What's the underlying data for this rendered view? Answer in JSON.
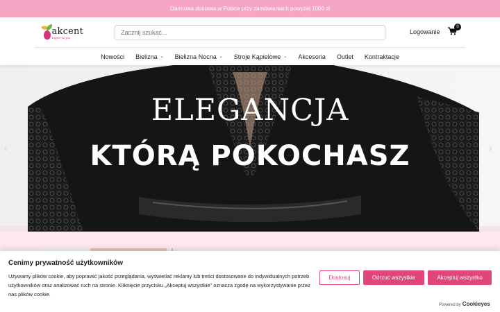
{
  "promo": {
    "text": "Darmowa dostawa w Polsce przy zamówieniach powyżej 1000 zł"
  },
  "header": {
    "logo_word": "akcent",
    "logo_tagline": "lingerie for you",
    "search_placeholder": "Zacznij szukać...",
    "login_label": "Logowanie",
    "cart_count": "0",
    "cart_icon": "shopping-cart-icon"
  },
  "nav": {
    "items": [
      {
        "label": "Nowości",
        "has_dropdown": false
      },
      {
        "label": "Bielizna",
        "has_dropdown": true
      },
      {
        "label": "Bielizna Nocna",
        "has_dropdown": true
      },
      {
        "label": "Stroje Kąpielowe",
        "has_dropdown": true
      },
      {
        "label": "Akcesoria",
        "has_dropdown": false
      },
      {
        "label": "Outlet",
        "has_dropdown": false
      },
      {
        "label": "Kontraktacje",
        "has_dropdown": false
      }
    ],
    "chevron": "⌄"
  },
  "hero": {
    "title_line1": "ELEGANCJA",
    "title_line2": "KTÓRĄ POKOCHASZ",
    "prev_arrow": "‹",
    "next_arrow": "›"
  },
  "cookie": {
    "title": "Cenimy prywatność użytkowników",
    "text": "Używamy plików cookie, aby poprawić jakość przeglądania, wyświetlać reklamy lub treści dostosowane do indywidualnych potrzeb użytkowników oraz analizować ruch na stronie. Kliknięcie przycisku „Akceptuj wszystkie\" oznacza zgodę na wykorzystywanie przez nas plików cookie.",
    "customize_label": "Dostosuj",
    "reject_label": "Odrzuć wszystkie",
    "accept_label": "Akceptuj wszystko",
    "powered_by": "Powered by",
    "powered_brand": "Cookieyes"
  },
  "colors": {
    "promo_bg": "#f4a6c4",
    "accent": "#e0457b",
    "hero_dark": "#141414",
    "pink_strip": "#fce8ee"
  }
}
